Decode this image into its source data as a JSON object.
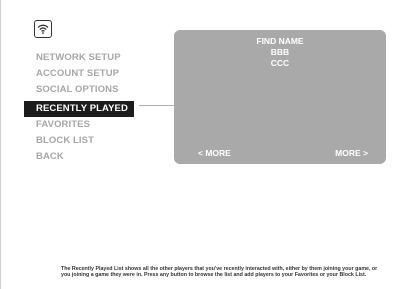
{
  "menu": {
    "items": [
      {
        "label": "NETWORK SETUP"
      },
      {
        "label": "ACCOUNT SETUP"
      },
      {
        "label": "SOCIAL OPTIONS"
      },
      {
        "label": "RECENTLY PLAYED"
      },
      {
        "label": "FAVORITES"
      },
      {
        "label": "BLOCK LIST"
      },
      {
        "label": "BACK"
      }
    ],
    "active": "RECENTLY PLAYED"
  },
  "panel": {
    "names": [
      "FIND NAME",
      "BBB",
      "CCC"
    ],
    "prev_label": "< MORE",
    "next_label": "MORE >"
  },
  "footer": {
    "help_text": "The Recently Played List shows all the other players that you've recently interacted with, either by them joining your game, or you joining a game they were in. Press any button to browse the list and add players to your Favorites or your Block List."
  },
  "colors": {
    "panel_bg": "#a9a9a9",
    "active_bg": "#1c1c1c",
    "inactive_text": "#a6a6a6"
  },
  "icons": {
    "wifi": "wifi-icon"
  }
}
